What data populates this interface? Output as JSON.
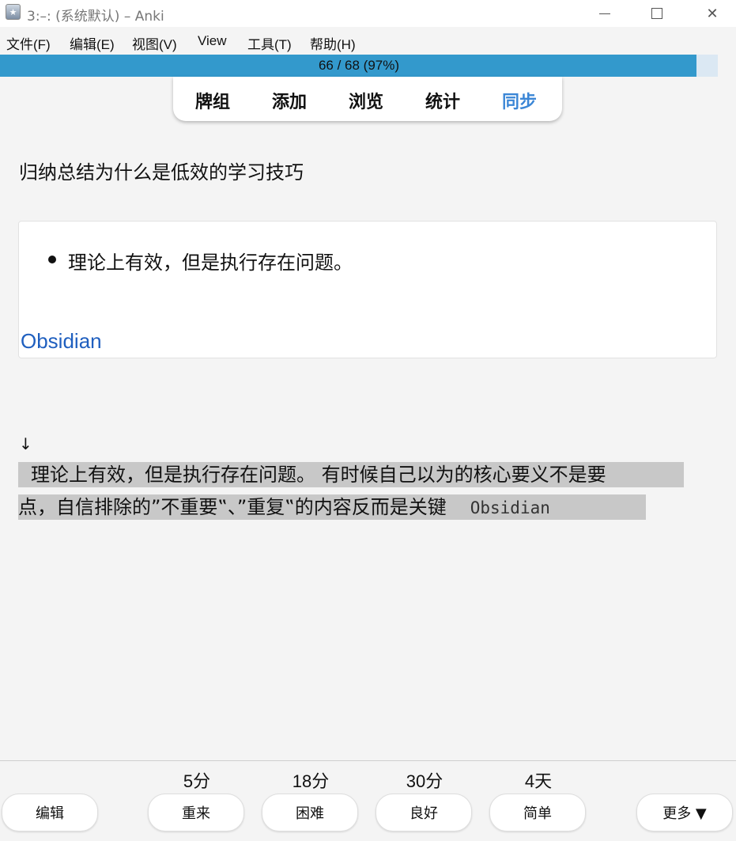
{
  "window": {
    "title": "3:–: (系统默认) – Anki"
  },
  "menu": [
    {
      "label": "文件(F)"
    },
    {
      "label": "编辑(E)"
    },
    {
      "label": "视图(V)"
    },
    {
      "label": "View"
    },
    {
      "label": "工具(T)"
    },
    {
      "label": "帮助(H)"
    }
  ],
  "progress": {
    "text": "66 / 68 (97%)",
    "fraction": 0.97,
    "color": "#3399cc"
  },
  "nav": {
    "decks": "牌组",
    "add": "添加",
    "browse": "浏览",
    "stats": "统计",
    "sync": "同步",
    "sync_color": "#3b86d6"
  },
  "card": {
    "question": "归纳总结为什么是低效的学习技巧",
    "answer_bullet": "理论上有效，但是执行存在问题。",
    "source_link": "Obsidian",
    "link_color": "#1f5fbf",
    "arrow": "↓",
    "highlight_line1": "理论上有效，但是执行存在问题。  有时候自己以为的核心要义不是要",
    "highlight_line2": "点，自信排除的”不重要‟、”重复‟的内容反而是关键",
    "highlight_source": "Obsidian",
    "highlight_color": "#c8c8c8"
  },
  "answer_buttons": {
    "again_interval": "5分",
    "hard_interval": "18分",
    "good_interval": "30分",
    "easy_interval": "4天",
    "edit": "编辑",
    "again": "重来",
    "hard": "困难",
    "good": "良好",
    "easy": "简单",
    "more": "更多 ▼"
  }
}
